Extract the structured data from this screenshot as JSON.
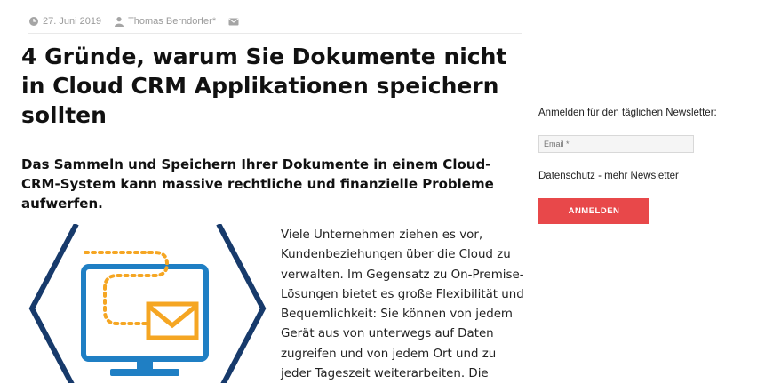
{
  "post_meta": {
    "date": "27. Juni 2019",
    "author": "Thomas Berndorfer*"
  },
  "article": {
    "title": "4 Gründe, warum Sie Dokumente nicht in Cloud CRM Applikationen speichern sollten",
    "subtitle": "Das Sammeln und Speichern Ihrer Dokumente in einem Cloud-CRM-System kann massive rechtliche und finanzielle Probleme aufwerfen.",
    "body": "Viele Unternehmen ziehen es vor, Kundenbeziehungen über die Cloud zu verwalten. Im Gegensatz zu On-Premise-Lösungen bietet es große Flexibilität und Bequemlichkeit: Sie können von jedem Gerät aus von unterwegs auf Daten zugreifen und von jedem Ort und zu jeder Tageszeit weiterarbeiten. Die"
  },
  "newsletter": {
    "label": "Anmelden für den täglichen Newsletter:",
    "email_placeholder": "Email *",
    "privacy_link": "Datenschutz - mehr Newsletter",
    "submit_label": "ANMELDEN"
  },
  "icons": {
    "date": "clock-icon",
    "author": "user-icon",
    "share": "mail-icon",
    "illustration": "monitor-envelope-icon"
  },
  "colors": {
    "accent_button": "#e8484a",
    "illustration_navy": "#173a6b",
    "illustration_blue": "#1f7fc4",
    "illustration_orange": "#f5a623"
  }
}
